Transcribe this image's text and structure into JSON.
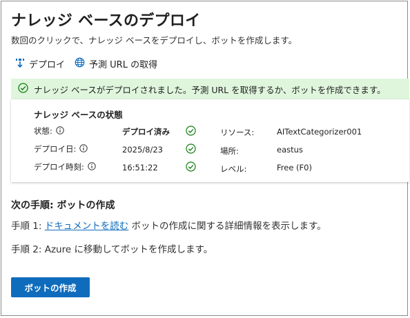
{
  "header": {
    "title": "ナレッジ ベースのデプロイ",
    "subtitle": "数回のクリックで、ナレッジ ベースをデプロイし、ボットを作成します。"
  },
  "toolbar": {
    "deploy_label": "デプロイ",
    "deploy_icon": "deploy-icon",
    "get_url_label": "予測 URL の取得",
    "get_url_icon": "globe-icon"
  },
  "banner": {
    "text": "ナレッジ ベースがデプロイされました。予測 URL を取得するか、ボットを作成できます。",
    "icon": "check-circle-icon",
    "color": "#dff6dd"
  },
  "status_card": {
    "title": "ナレッジ ベースの状態",
    "rows": [
      {
        "label": "状態:",
        "value": "デプロイ済み",
        "right_label": "リソース:",
        "right_value": "AITextCategorizer001"
      },
      {
        "label": "デプロイ日:",
        "value": "2025/8/23",
        "right_label": "場所:",
        "right_value": "eastus"
      },
      {
        "label": "デプロイ時刻:",
        "value": "16:51:22",
        "right_label": "レベル:",
        "right_value": "Free (F0)"
      }
    ]
  },
  "next_steps": {
    "title": "次の手順: ボットの作成",
    "step1_prefix": "手順 1: ",
    "step1_link": "ドキュメントを読む",
    "step1_suffix": " ボットの作成に関する詳細情報を表示します。",
    "step2": "手順 2: Azure に移動してボットを作成します。"
  },
  "create_bot_button": {
    "label": "ボットの作成"
  },
  "colors": {
    "accent": "#0f6cbd",
    "success": "#107c10",
    "banner_bg": "#dff6dd"
  }
}
